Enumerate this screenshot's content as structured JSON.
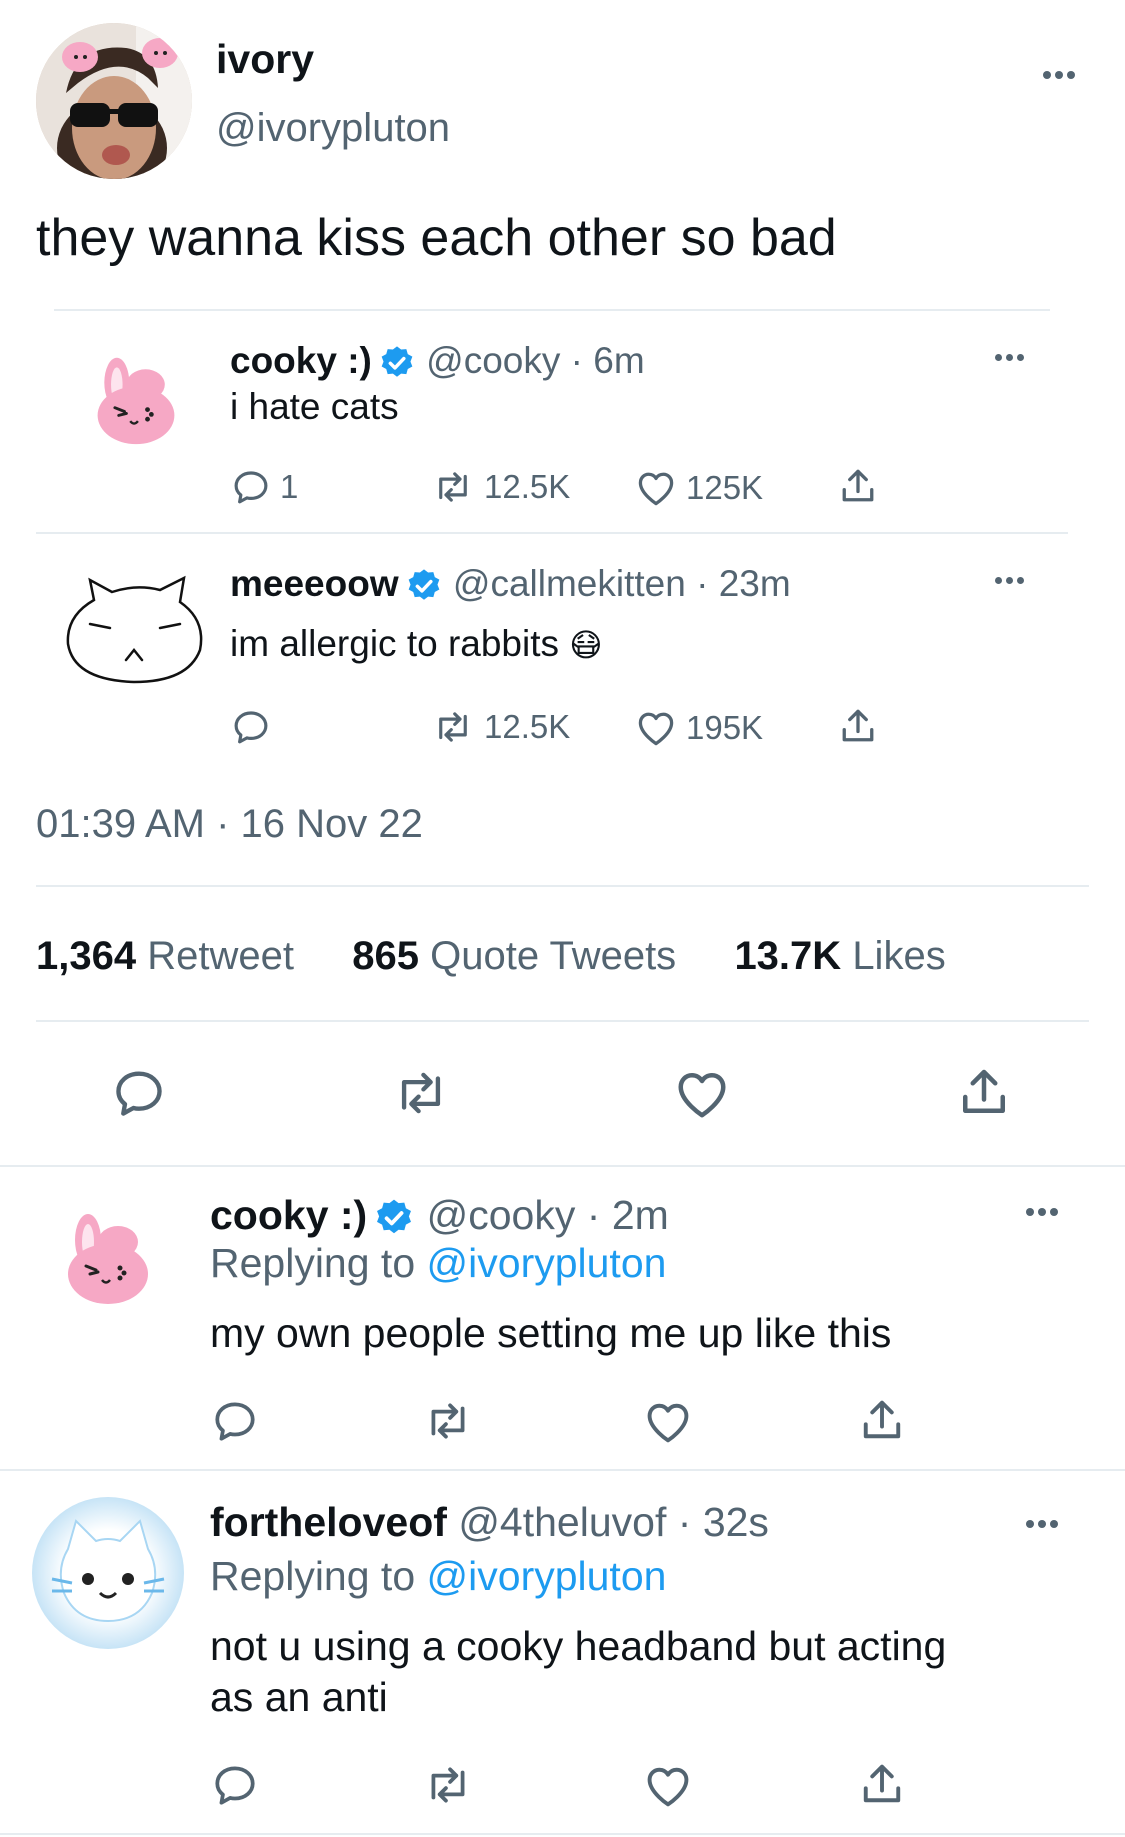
{
  "main_tweet": {
    "name": "ivory",
    "handle": "@ivorypluton",
    "text": "they wanna kiss each other so bad",
    "timestamp": "01:39 AM · 16 Nov 22",
    "stats": {
      "retweets_count": "1,364",
      "retweets_label": "Retweet",
      "quotes_count": "865",
      "quotes_label": "Quote Tweets",
      "likes_count": "13.7K",
      "likes_label": "Likes"
    }
  },
  "quoted": [
    {
      "name": "cooky :)",
      "handle": "@cooky",
      "time": "6m",
      "text": "i hate cats",
      "replies": "1",
      "retweets": "12.5K",
      "likes": "125K"
    },
    {
      "name": "meeeoow",
      "handle": "@callmekitten",
      "time": "23m",
      "text": "im allergic to rabbits",
      "emoji": "😷",
      "replies": "",
      "retweets": "12.5K",
      "likes": "195K"
    }
  ],
  "replies": [
    {
      "name": "cooky :)",
      "handle": "@cooky",
      "time": "2m",
      "replying_label": "Replying to",
      "replying_to": "@ivorypluton",
      "text": "my own people setting me up like this"
    },
    {
      "name": "fortheloveof",
      "handle": "@4theluvof",
      "time": "32s",
      "replying_label": "Replying to",
      "replying_to": "@ivorypluton",
      "text_line1": "not u using a cooky headband but acting",
      "text_line2": "as an anti"
    }
  ],
  "separator": "·",
  "icons": [
    "more-icon",
    "verified-icon",
    "reply-icon",
    "retweet-icon",
    "like-icon",
    "share-icon"
  ],
  "colors": {
    "accent": "#1d9bf0",
    "text": "#0f1419",
    "secondary": "#536471",
    "divider": "#e6ecf0",
    "cooky_pink": "#f6a8c5"
  }
}
